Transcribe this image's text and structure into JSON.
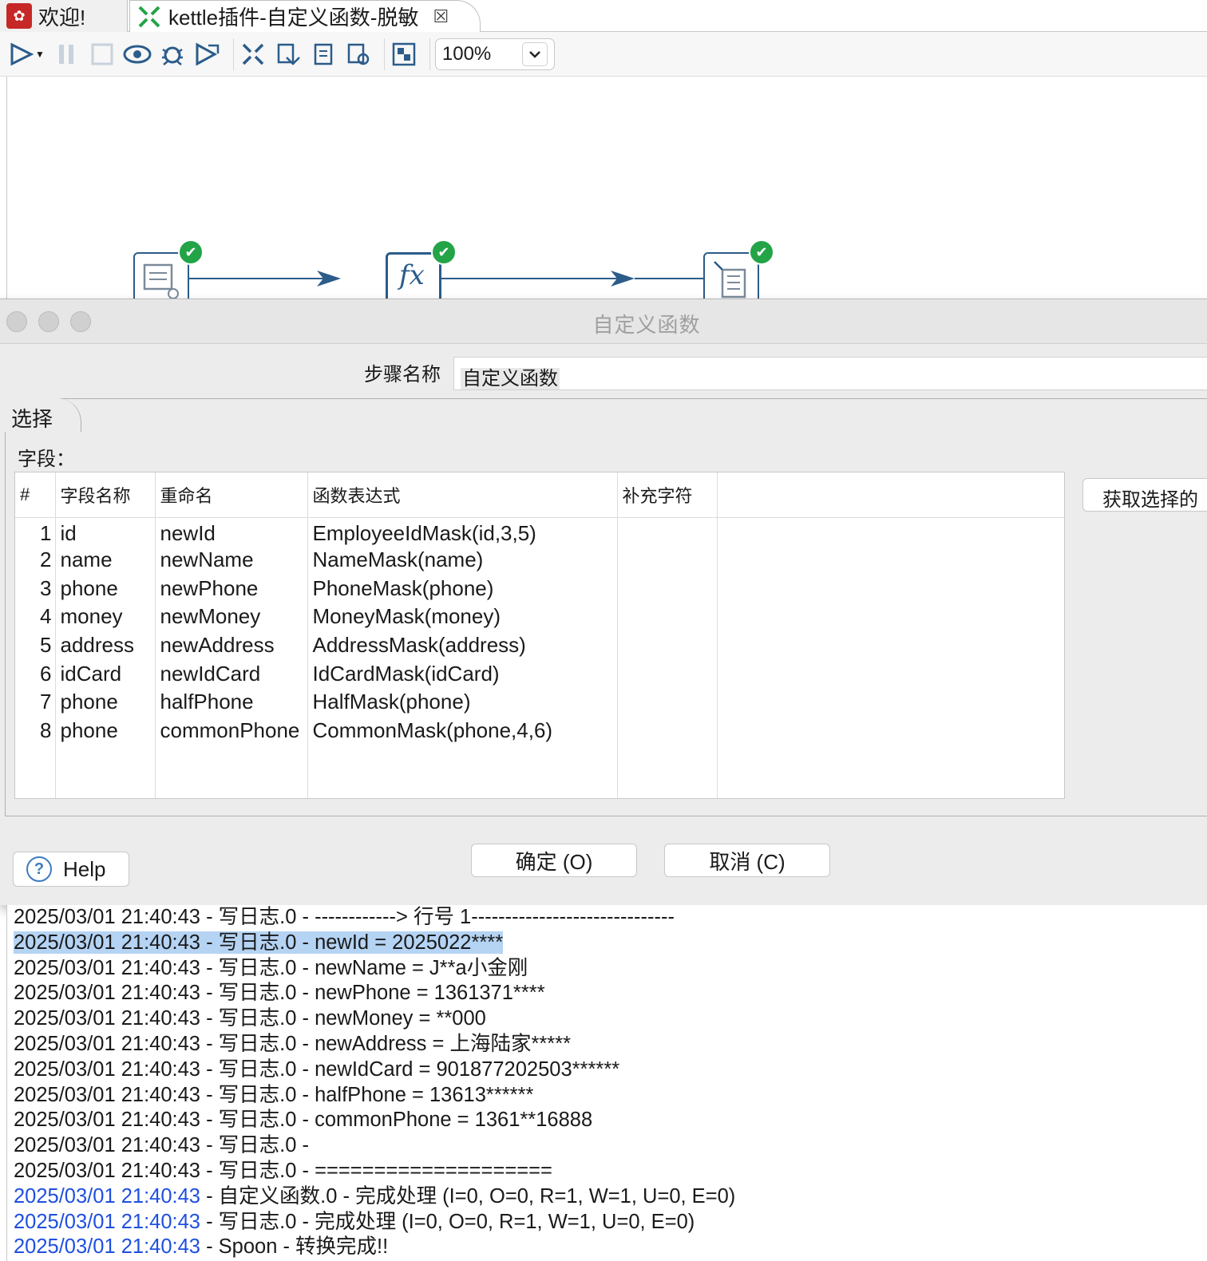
{
  "tabs": [
    {
      "label": "欢迎!",
      "icon": "kettle-logo-icon"
    },
    {
      "label": "kettle插件-自定义函数-脱敏",
      "icon": "transformation-icon"
    }
  ],
  "toolbar": {
    "zoom": "100%",
    "icons": [
      "run-icon",
      "pause-icon",
      "stop-icon",
      "preview-icon",
      "debug-icon",
      "replay-icon",
      "verify-icon",
      "impact-icon",
      "sql-icon",
      "explore-db-icon",
      "zoom-fit-icon"
    ]
  },
  "canvas": {
    "steps": [
      {
        "icon": "data-grid-icon",
        "status": "success"
      },
      {
        "icon": "fx-icon",
        "symbol": "fx",
        "status": "success"
      },
      {
        "icon": "write-log-icon",
        "status": "success"
      }
    ]
  },
  "dialog": {
    "title": "自定义函数",
    "step_name_label": "步骤名称",
    "step_name_value": "自定义函数",
    "tab_label": "选择",
    "fields_label": "字段：",
    "get_button": "获取选择的",
    "help_button": "Help",
    "ok_button": "确定 (O)",
    "cancel_button": "取消 (C)",
    "columns": [
      "#",
      "字段名称",
      "重命名",
      "函数表达式",
      "补充字符"
    ],
    "rows": [
      {
        "n": "1",
        "field": "id",
        "rename": "newId",
        "expr": "EmployeeIdMask(id,3,5)",
        "pad": ""
      },
      {
        "n": "2",
        "field": "name",
        "rename": "newName",
        "expr": "NameMask(name)",
        "pad": ""
      },
      {
        "n": "3",
        "field": "phone",
        "rename": "newPhone",
        "expr": "PhoneMask(phone)",
        "pad": ""
      },
      {
        "n": "4",
        "field": "money",
        "rename": "newMoney",
        "expr": "MoneyMask(money)",
        "pad": ""
      },
      {
        "n": "5",
        "field": "address",
        "rename": "newAddress",
        "expr": "AddressMask(address)",
        "pad": ""
      },
      {
        "n": "6",
        "field": "idCard",
        "rename": "newIdCard",
        "expr": "IdCardMask(idCard)",
        "pad": ""
      },
      {
        "n": "7",
        "field": "phone",
        "rename": "halfPhone",
        "expr": "HalfMask(phone)",
        "pad": ""
      },
      {
        "n": "8",
        "field": "phone",
        "rename": "commonPhone",
        "expr": "CommonMask(phone,4,6)",
        "pad": ""
      }
    ]
  },
  "log": [
    {
      "ts": "2025/03/01 21:40:43",
      "msg": " - 写日志.0 - ------------> 行号 1------------------------------",
      "blue": false,
      "selected": false
    },
    {
      "ts": "2025/03/01 21:40:43",
      "msg": " - 写日志.0 - newId = 2025022****",
      "blue": false,
      "selected": true
    },
    {
      "ts": "2025/03/01 21:40:43",
      "msg": " - 写日志.0 - newName = J**a小金刚",
      "blue": false,
      "selected": false
    },
    {
      "ts": "2025/03/01 21:40:43",
      "msg": " - 写日志.0 - newPhone = 1361371****",
      "blue": false,
      "selected": false
    },
    {
      "ts": "2025/03/01 21:40:43",
      "msg": " - 写日志.0 - newMoney = **000",
      "blue": false,
      "selected": false
    },
    {
      "ts": "2025/03/01 21:40:43",
      "msg": " - 写日志.0 - newAddress = 上海陆家*****",
      "blue": false,
      "selected": false
    },
    {
      "ts": "2025/03/01 21:40:43",
      "msg": " - 写日志.0 - newIdCard = 901877202503******",
      "blue": false,
      "selected": false
    },
    {
      "ts": "2025/03/01 21:40:43",
      "msg": " - 写日志.0 - halfPhone = 13613******",
      "blue": false,
      "selected": false
    },
    {
      "ts": "2025/03/01 21:40:43",
      "msg": " - 写日志.0 - commonPhone = 1361**16888",
      "blue": false,
      "selected": false
    },
    {
      "ts": "2025/03/01 21:40:43",
      "msg": " - 写日志.0 - ",
      "blue": false,
      "selected": false
    },
    {
      "ts": "2025/03/01 21:40:43",
      "msg": " - 写日志.0 - ====================",
      "blue": false,
      "selected": false
    },
    {
      "ts": "2025/03/01 21:40:43",
      "msg": " - 自定义函数.0 - 完成处理 (I=0, O=0, R=1, W=1, U=0, E=0)",
      "blue": true,
      "selected": false
    },
    {
      "ts": "2025/03/01 21:40:43",
      "msg": " - 写日志.0 - 完成处理 (I=0, O=0, R=1, W=1, U=0, E=0)",
      "blue": true,
      "selected": false
    },
    {
      "ts": "2025/03/01 21:40:43",
      "msg": " - Spoon - 转换完成!!",
      "blue": true,
      "selected": false
    }
  ],
  "colors": {
    "accent": "#2b5c8a",
    "success": "#22a447",
    "log_blue": "#1f4fe0",
    "selection": "#b5d3f3"
  }
}
